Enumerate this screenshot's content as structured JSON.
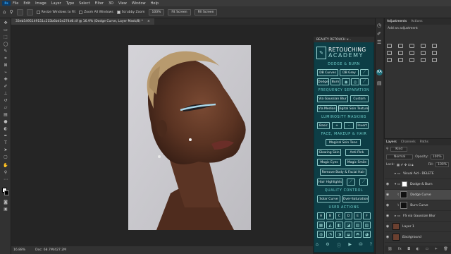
{
  "app": {
    "logo": "Ps"
  },
  "menu": [
    "File",
    "Edit",
    "Image",
    "Layer",
    "Type",
    "Select",
    "Filter",
    "3D",
    "View",
    "Window",
    "Help"
  ],
  "options": {
    "resize_windows": "Resize Windows to Fit",
    "zoom_all": "Zoom All Windows",
    "scrubby_zoom": "Scrubby Zoom",
    "btn_100": "100%",
    "fit_screen": "Fit Screen",
    "fill_screen": "Fill Screen"
  },
  "document_tab": {
    "title": "33eb5495149151c215b6bd1e274d6.tif @ 16.9% (Dodge Curve, Layer Mask/8) *",
    "close": "×"
  },
  "status": {
    "zoom": "16.88%",
    "doc": "Doc: 68.7M/427.2M"
  },
  "panel": {
    "header": "BEAUTY RETOUCH v...",
    "brand_line1": "RETOUCHING",
    "brand_line2": "ACADEMY",
    "sections": {
      "dodge": "DODGE & BURN",
      "freq": "FREQUENCY SEPARATION",
      "lum": "LUMINOSITY MASKING",
      "face": "FACE, MAKEUP & HAIR",
      "quality": "QUALITY CONTROL",
      "user": "USER ACTIONS"
    },
    "buttons": {
      "db_curves": "DB Curves",
      "db_grey": "DB Grey",
      "dodge": "Dodge",
      "burn": "Burn",
      "via_gaussian": "Via Gaussian Blur",
      "custom": "Custom",
      "via_median": "Via Median",
      "digital_skin": "Digital Skin Texture",
      "basic": "Basic",
      "plus": "+",
      "minus": "-",
      "invert": "Invert",
      "magical_skin": "Magical Skin Tone",
      "glowing_skin": "Glowing Skin",
      "anti_pink": "Anti-Pink",
      "magic_eyes": "Magic Eyes",
      "magic_smile": "Magic Smile",
      "remove_body_hair": "Remove Body & Facial Hair",
      "hair_highlights": "Hair Highlights",
      "solar_curve": "Solar Curve",
      "over_saturation": "Over-Saturation",
      "user_a": "A",
      "user_b": "B",
      "user_c": "C",
      "user_d": "D",
      "user_e": "E",
      "user_f": "F"
    }
  },
  "adjustments": {
    "tab1": "Adjustments",
    "tab2": "Actions",
    "add": "Add an adjustment"
  },
  "layers": {
    "tabs": [
      "Layers",
      "Channels",
      "Paths"
    ],
    "kind": "Kind",
    "blend": "Normal",
    "opacity_label": "Opacity:",
    "opacity": "100%",
    "lock_label": "Lock:",
    "fill_label": "Fill:",
    "fill": "100%",
    "items": [
      "Visual Aid - DELETE",
      "Dodge & Burn",
      "Dodge Curve",
      "Burn Curve",
      "FS via Gaussian Blur",
      "Layer 1",
      "Background"
    ]
  },
  "colors": {
    "panel_bg": "#0d3e46",
    "accent": "#6fd0cc",
    "ps_blue": "#31a8ff"
  }
}
